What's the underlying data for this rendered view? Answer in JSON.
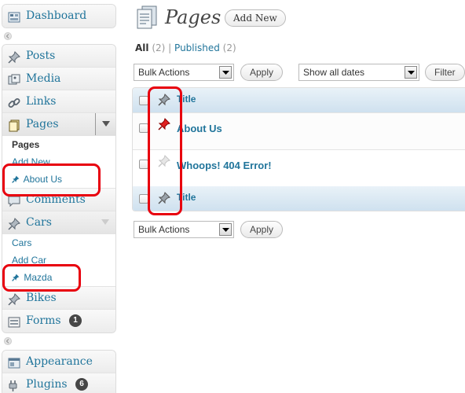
{
  "sidebar": {
    "dashboard": "Dashboard",
    "items1": [
      "Posts",
      "Media",
      "Links"
    ],
    "pages": {
      "label": "Pages",
      "sub": [
        "Pages",
        "Add New",
        "About Us"
      ]
    },
    "comments": "Comments",
    "cars": {
      "label": "Cars",
      "sub": [
        "Cars",
        "Add Car",
        "Mazda"
      ]
    },
    "bikes": "Bikes",
    "forms": {
      "label": "Forms",
      "badge": "1"
    },
    "appearance": "Appearance",
    "plugins": {
      "label": "Plugins",
      "badge": "6"
    }
  },
  "header": {
    "title": "Pages",
    "add_new": "Add New"
  },
  "filters": {
    "all": "All",
    "all_count": "(2)",
    "separator": "|",
    "published": "Published",
    "published_count": "(2)"
  },
  "toolbar": {
    "bulk_actions": "Bulk Actions",
    "apply": "Apply",
    "dates": "Show all dates",
    "filter": "Filter"
  },
  "table": {
    "column_title": "Title",
    "rows": [
      "About Us",
      "Whoops! 404 Error!"
    ]
  },
  "colors": {
    "link": "#21759b",
    "annotation": "#e8000e",
    "pinned": "#e02020"
  }
}
